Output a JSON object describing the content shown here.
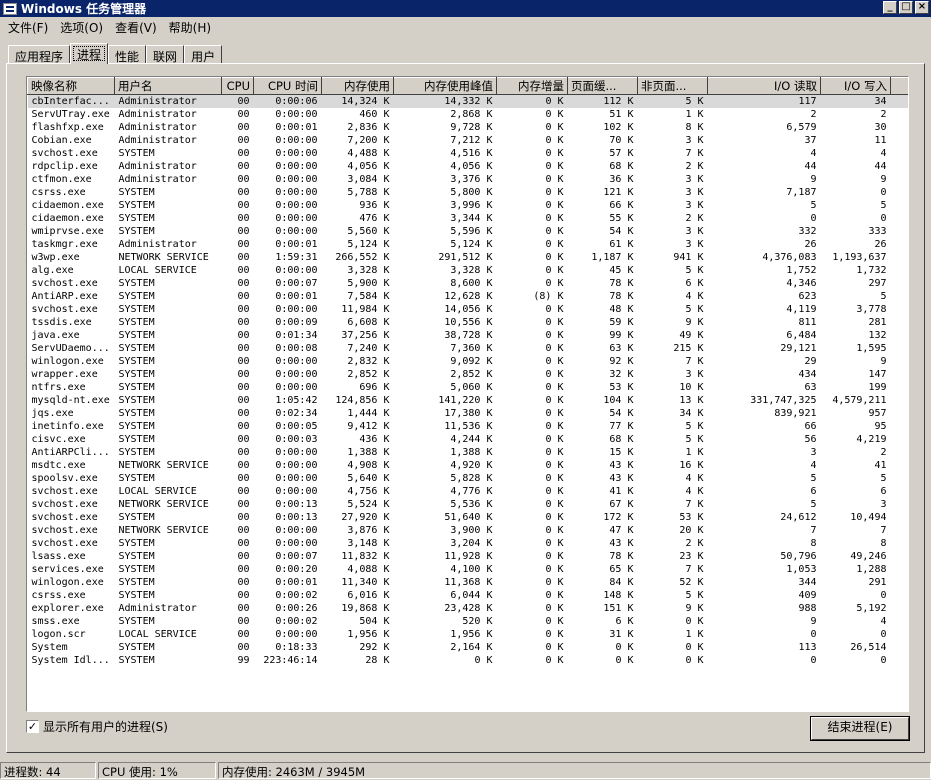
{
  "window": {
    "title": "Windows 任务管理器",
    "buttons": [
      "_",
      "□",
      "×"
    ]
  },
  "menu": [
    "文件(F)",
    "选项(O)",
    "查看(V)",
    "帮助(H)"
  ],
  "tabs": [
    "应用程序",
    "进程",
    "性能",
    "联网",
    "用户"
  ],
  "active_tab": 1,
  "columns": [
    "映像名称",
    "用户名",
    "CPU",
    "CPU 时间",
    "内存使用",
    "内存使用峰值",
    "内存增量",
    "页面缓...",
    "非页面...",
    "I/O 读取",
    "I/O 写入"
  ],
  "processes": [
    [
      "cbInterfac...",
      "Administrator",
      "00",
      "0:00:06",
      "14,324 K",
      "14,332 K",
      "0 K",
      "112 K",
      "5 K",
      "117",
      "34"
    ],
    [
      "ServUTray.exe",
      "Administrator",
      "00",
      "0:00:00",
      "460 K",
      "2,868 K",
      "0 K",
      "51 K",
      "1 K",
      "2",
      "2"
    ],
    [
      "flashfxp.exe",
      "Administrator",
      "00",
      "0:00:01",
      "2,836 K",
      "9,728 K",
      "0 K",
      "102 K",
      "8 K",
      "6,579",
      "30"
    ],
    [
      "Cobian.exe",
      "Administrator",
      "00",
      "0:00:00",
      "7,200 K",
      "7,212 K",
      "0 K",
      "70 K",
      "3 K",
      "37",
      "11"
    ],
    [
      "svchost.exe",
      "SYSTEM",
      "00",
      "0:00:00",
      "4,488 K",
      "4,516 K",
      "0 K",
      "57 K",
      "7 K",
      "4",
      "4"
    ],
    [
      "rdpclip.exe",
      "Administrator",
      "00",
      "0:00:00",
      "4,056 K",
      "4,056 K",
      "0 K",
      "68 K",
      "2 K",
      "44",
      "44"
    ],
    [
      "ctfmon.exe",
      "Administrator",
      "00",
      "0:00:00",
      "3,084 K",
      "3,376 K",
      "0 K",
      "36 K",
      "3 K",
      "9",
      "9"
    ],
    [
      "csrss.exe",
      "SYSTEM",
      "00",
      "0:00:00",
      "5,788 K",
      "5,800 K",
      "0 K",
      "121 K",
      "3 K",
      "7,187",
      "0"
    ],
    [
      "cidaemon.exe",
      "SYSTEM",
      "00",
      "0:00:00",
      "936 K",
      "3,996 K",
      "0 K",
      "66 K",
      "3 K",
      "5",
      "5"
    ],
    [
      "cidaemon.exe",
      "SYSTEM",
      "00",
      "0:00:00",
      "476 K",
      "3,344 K",
      "0 K",
      "55 K",
      "2 K",
      "0",
      "0"
    ],
    [
      "wmiprvse.exe",
      "SYSTEM",
      "00",
      "0:00:00",
      "5,560 K",
      "5,596 K",
      "0 K",
      "54 K",
      "3 K",
      "332",
      "333"
    ],
    [
      "taskmgr.exe",
      "Administrator",
      "00",
      "0:00:01",
      "5,124 K",
      "5,124 K",
      "0 K",
      "61 K",
      "3 K",
      "26",
      "26"
    ],
    [
      "w3wp.exe",
      "NETWORK SERVICE",
      "00",
      "1:59:31",
      "266,552 K",
      "291,512 K",
      "0 K",
      "1,187 K",
      "941 K",
      "4,376,083",
      "1,193,637"
    ],
    [
      "alg.exe",
      "LOCAL SERVICE",
      "00",
      "0:00:00",
      "3,328 K",
      "3,328 K",
      "0 K",
      "45 K",
      "5 K",
      "1,752",
      "1,732"
    ],
    [
      "svchost.exe",
      "SYSTEM",
      "00",
      "0:00:07",
      "5,900 K",
      "8,600 K",
      "0 K",
      "78 K",
      "6 K",
      "4,346",
      "297"
    ],
    [
      "AntiARP.exe",
      "SYSTEM",
      "00",
      "0:00:01",
      "7,584 K",
      "12,628 K",
      "(8) K",
      "78 K",
      "4 K",
      "623",
      "5"
    ],
    [
      "svchost.exe",
      "SYSTEM",
      "00",
      "0:00:00",
      "11,984 K",
      "14,056 K",
      "0 K",
      "48 K",
      "5 K",
      "4,119",
      "3,778"
    ],
    [
      "tssdis.exe",
      "SYSTEM",
      "00",
      "0:00:09",
      "6,608 K",
      "10,556 K",
      "0 K",
      "59 K",
      "9 K",
      "811",
      "281"
    ],
    [
      "java.exe",
      "SYSTEM",
      "00",
      "0:01:34",
      "37,256 K",
      "38,728 K",
      "0 K",
      "99 K",
      "49 K",
      "6,484",
      "132"
    ],
    [
      "ServUDaemo...",
      "SYSTEM",
      "00",
      "0:00:08",
      "7,240 K",
      "7,360 K",
      "0 K",
      "63 K",
      "215 K",
      "29,121",
      "1,595"
    ],
    [
      "winlogon.exe",
      "SYSTEM",
      "00",
      "0:00:00",
      "2,832 K",
      "9,092 K",
      "0 K",
      "92 K",
      "7 K",
      "29",
      "9"
    ],
    [
      "wrapper.exe",
      "SYSTEM",
      "00",
      "0:00:00",
      "2,852 K",
      "2,852 K",
      "0 K",
      "32 K",
      "3 K",
      "434",
      "147"
    ],
    [
      "ntfrs.exe",
      "SYSTEM",
      "00",
      "0:00:00",
      "696 K",
      "5,060 K",
      "0 K",
      "53 K",
      "10 K",
      "63",
      "199"
    ],
    [
      "mysqld-nt.exe",
      "SYSTEM",
      "00",
      "1:05:42",
      "124,856 K",
      "141,220 K",
      "0 K",
      "104 K",
      "13 K",
      "331,747,325",
      "4,579,211"
    ],
    [
      "jqs.exe",
      "SYSTEM",
      "00",
      "0:02:34",
      "1,444 K",
      "17,380 K",
      "0 K",
      "54 K",
      "34 K",
      "839,921",
      "957"
    ],
    [
      "inetinfo.exe",
      "SYSTEM",
      "00",
      "0:00:05",
      "9,412 K",
      "11,536 K",
      "0 K",
      "77 K",
      "5 K",
      "66",
      "95"
    ],
    [
      "cisvc.exe",
      "SYSTEM",
      "00",
      "0:00:03",
      "436 K",
      "4,244 K",
      "0 K",
      "68 K",
      "5 K",
      "56",
      "4,219"
    ],
    [
      "AntiARPCli...",
      "SYSTEM",
      "00",
      "0:00:00",
      "1,388 K",
      "1,388 K",
      "0 K",
      "15 K",
      "1 K",
      "3",
      "2"
    ],
    [
      "msdtc.exe",
      "NETWORK SERVICE",
      "00",
      "0:00:00",
      "4,908 K",
      "4,920 K",
      "0 K",
      "43 K",
      "16 K",
      "4",
      "41"
    ],
    [
      "spoolsv.exe",
      "SYSTEM",
      "00",
      "0:00:00",
      "5,640 K",
      "5,828 K",
      "0 K",
      "43 K",
      "4 K",
      "5",
      "5"
    ],
    [
      "svchost.exe",
      "LOCAL SERVICE",
      "00",
      "0:00:00",
      "4,756 K",
      "4,776 K",
      "0 K",
      "41 K",
      "4 K",
      "6",
      "6"
    ],
    [
      "svchost.exe",
      "NETWORK SERVICE",
      "00",
      "0:00:13",
      "5,524 K",
      "5,536 K",
      "0 K",
      "67 K",
      "7 K",
      "5",
      "3"
    ],
    [
      "svchost.exe",
      "SYSTEM",
      "00",
      "0:00:13",
      "27,920 K",
      "51,640 K",
      "0 K",
      "172 K",
      "53 K",
      "24,612",
      "10,494"
    ],
    [
      "svchost.exe",
      "NETWORK SERVICE",
      "00",
      "0:00:00",
      "3,876 K",
      "3,900 K",
      "0 K",
      "47 K",
      "20 K",
      "7",
      "7"
    ],
    [
      "svchost.exe",
      "SYSTEM",
      "00",
      "0:00:00",
      "3,148 K",
      "3,204 K",
      "0 K",
      "43 K",
      "2 K",
      "8",
      "8"
    ],
    [
      "lsass.exe",
      "SYSTEM",
      "00",
      "0:00:07",
      "11,832 K",
      "11,928 K",
      "0 K",
      "78 K",
      "23 K",
      "50,796",
      "49,246"
    ],
    [
      "services.exe",
      "SYSTEM",
      "00",
      "0:00:20",
      "4,088 K",
      "4,100 K",
      "0 K",
      "65 K",
      "7 K",
      "1,053",
      "1,288"
    ],
    [
      "winlogon.exe",
      "SYSTEM",
      "00",
      "0:00:01",
      "11,340 K",
      "11,368 K",
      "0 K",
      "84 K",
      "52 K",
      "344",
      "291"
    ],
    [
      "csrss.exe",
      "SYSTEM",
      "00",
      "0:00:02",
      "6,016 K",
      "6,044 K",
      "0 K",
      "148 K",
      "5 K",
      "409",
      "0"
    ],
    [
      "explorer.exe",
      "Administrator",
      "00",
      "0:00:26",
      "19,868 K",
      "23,428 K",
      "0 K",
      "151 K",
      "9 K",
      "988",
      "5,192"
    ],
    [
      "smss.exe",
      "SYSTEM",
      "00",
      "0:00:02",
      "504 K",
      "520 K",
      "0 K",
      "6 K",
      "0 K",
      "9",
      "4"
    ],
    [
      "logon.scr",
      "LOCAL SERVICE",
      "00",
      "0:00:00",
      "1,956 K",
      "1,956 K",
      "0 K",
      "31 K",
      "1 K",
      "0",
      "0"
    ],
    [
      "System",
      "SYSTEM",
      "00",
      "0:18:33",
      "292 K",
      "2,164 K",
      "0 K",
      "0 K",
      "0 K",
      "113",
      "26,514"
    ],
    [
      "System Idl...",
      "SYSTEM",
      "99",
      "223:46:14",
      "28 K",
      "0 K",
      "0 K",
      "0 K",
      "0 K",
      "0",
      "0"
    ]
  ],
  "show_all_users": {
    "label": "显示所有用户的进程(S)",
    "checked": true,
    "mark": "✓"
  },
  "end_process_label": "结束进程(E)",
  "status": {
    "process_count": "进程数: 44",
    "cpu_usage": "CPU 使用: 1%",
    "memory_usage": "内存使用: 2463M / 3945M"
  }
}
